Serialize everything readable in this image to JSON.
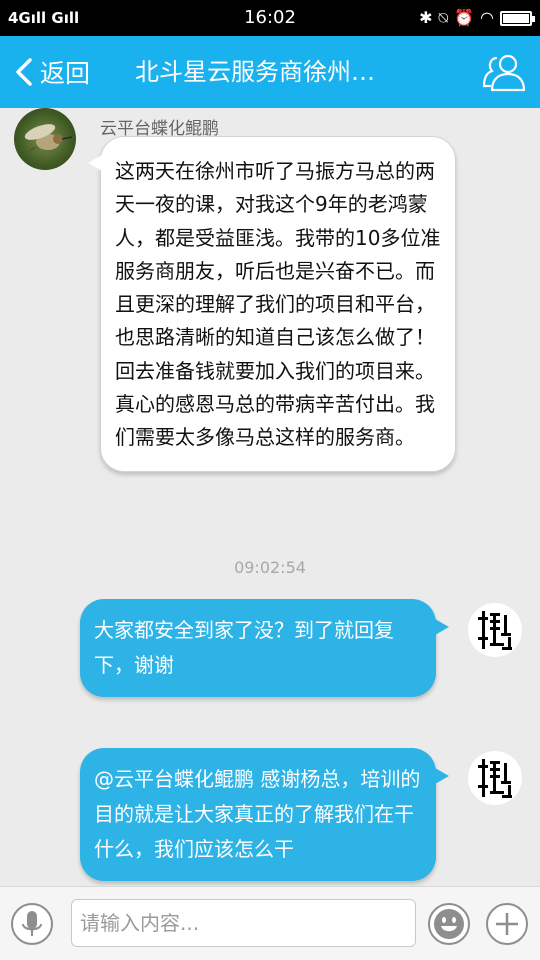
{
  "status_bar": {
    "network": "4G",
    "time": "16:02",
    "icons": [
      "bluetooth-icon",
      "mute-icon",
      "alarm-icon",
      "wifi-icon",
      "battery-icon"
    ]
  },
  "header": {
    "back_label": "返回",
    "title": "北斗星云服务商徐州…",
    "members_icon": "group-members-icon"
  },
  "messages": [
    {
      "direction": "incoming",
      "sender": "云平台蝶化鲲鹏",
      "text": "这两天在徐州市听了马振方马总的两天一夜的课，对我这个9年的老鸿蒙人，都是受益匪浅。我带的10多位准服务商朋友，听后也是兴奋不已。而且更深的理解了我们的项目和平台，也思路清晰的知道自己该怎么做了！回去准备钱就要加入我们的项目来。真心的感恩马总的带病辛苦付出。我们需要太多像马总这样的服务商。"
    },
    {
      "type": "timestamp",
      "text": "09:02:54"
    },
    {
      "direction": "outgoing",
      "text": "大家都安全到家了没？到了就回复下，谢谢"
    },
    {
      "direction": "outgoing",
      "text": "@云平台蝶化鲲鹏 感谢杨总，培训的目的就是让大家真正的了解我们在干什么，我们应该怎么干"
    }
  ],
  "input_bar": {
    "placeholder": "请输入内容...",
    "voice_icon": "microphone-icon",
    "emoji_icon": "smiley-icon",
    "more_icon": "plus-icon"
  },
  "colors": {
    "accent": "#1ab1ef",
    "outgoing_bubble": "#2eb3e7",
    "background": "#ebebeb"
  }
}
